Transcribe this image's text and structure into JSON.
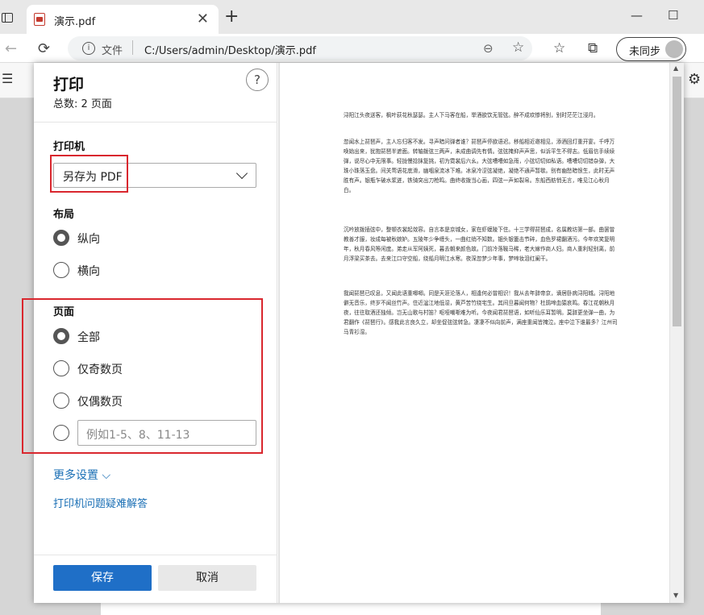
{
  "browser": {
    "tab_title": "演示.pdf",
    "tab_close": "✕",
    "new_tab": "+",
    "minimize": "—",
    "maximize": "☐",
    "back": "←",
    "reload": "⟳",
    "url_scheme": "文件",
    "url_path": "C:/Users/admin/Desktop/演示.pdf",
    "profile_label": "未同步",
    "icons": [
      "window-icon",
      "pdf-icon",
      "info-icon",
      "zoom-out-icon",
      "favorite-add-icon",
      "favorites-icon",
      "collections-icon",
      "avatar-icon",
      "settings-icon"
    ]
  },
  "dialog": {
    "title": "打印",
    "total": "总数: 2 页面",
    "help": "?",
    "printer_label": "打印机",
    "printer_value": "另存为 PDF",
    "layout_label": "布局",
    "layout_options": [
      "纵向",
      "横向"
    ],
    "layout_selected": "纵向",
    "pages_label": "页面",
    "pages_options": [
      "全部",
      "仅奇数页",
      "仅偶数页"
    ],
    "pages_selected": "全部",
    "range_placeholder": "例如1-5、8、11-13",
    "more_settings": "更多设置 ⌵",
    "troubleshoot": "打印机问题疑难解答",
    "save_button": "保存",
    "cancel_button": "取消"
  },
  "preview": {
    "paragraphs": [
      "浔阳江头夜送客，枫叶荻花秋瑟瑟。主人下马客在船，举酒欲饮无管弦。醉不成欢惨将别，别时茫茫江浸月。",
      "忽闻水上琵琶声，主人忘归客不发。寻声暗问弹者谁？琵琶声停欲语迟。移船相近邀相见，添酒回灯重开宴。千呼万唤始出来，犹抱琵琶半遮面。转轴拨弦三两声，未成曲调先有情。弦弦掩抑声声思，似诉平生不得志。低眉信手续续弹，说尽心中无限事。轻拢慢捻抹复挑，初为霓裳后六幺。大弦嘈嘈如急雨，小弦切切如私语。嘈嘈切切错杂弹，大珠小珠落玉盘。间关莺语花底滑，幽咽泉流冰下难。冰泉冷涩弦凝绝，凝绝不通声暂歇。别有幽愁暗恨生，此时无声胜有声。银瓶乍破水浆迸，铁骑突出刀枪鸣。曲终收拨当心画，四弦一声如裂帛。东船西舫悄无言，唯见江心秋月白。",
      "沉吟放拨插弦中，整顿衣裳起敛容。自言本是京城女，家在虾蟆陵下住。十三学得琵琶成，名属教坊第一部。曲罢曾教善才服，妆成每被秋娘妒。五陵年少争缠头，一曲红绡不知数。钿头银篦击节碎，血色罗裙翻酒污。今年欢笑复明年，秋月春风等闲度。弟走从军阿姨死，暮去朝来颜色故。门前冷落鞍马稀，老大嫁作商人妇。商人重利轻别离，前月浮梁买茶去。去来江口守空船，绕船月明江水寒。夜深忽梦少年事，梦啼妆泪红阑干。",
      "我闻琵琶已叹息，又闻此语重唧唧。同是天涯沦落人，相逢何必曾相识！我从去年辞帝京，谪居卧病浔阳城。浔阳地僻无音乐，终岁不闻丝竹声。住近湓江地低湿，黄芦苦竹绕宅生。其间旦暮闻何物？杜鹃啼血猿哀鸣。春江花朝秋月夜，往往取酒还独倾。岂无山歌与村笛？呕哑嘲哳难为听。今夜闻君琵琶语，如听仙乐耳暂明。莫辞更坐弹一曲，为君翻作《琵琶行》。感我此言良久立，却坐促弦弦转急。凄凄不似向前声，满座重闻皆掩泣。座中泣下谁最多？江州司马青衫湿。"
    ]
  }
}
